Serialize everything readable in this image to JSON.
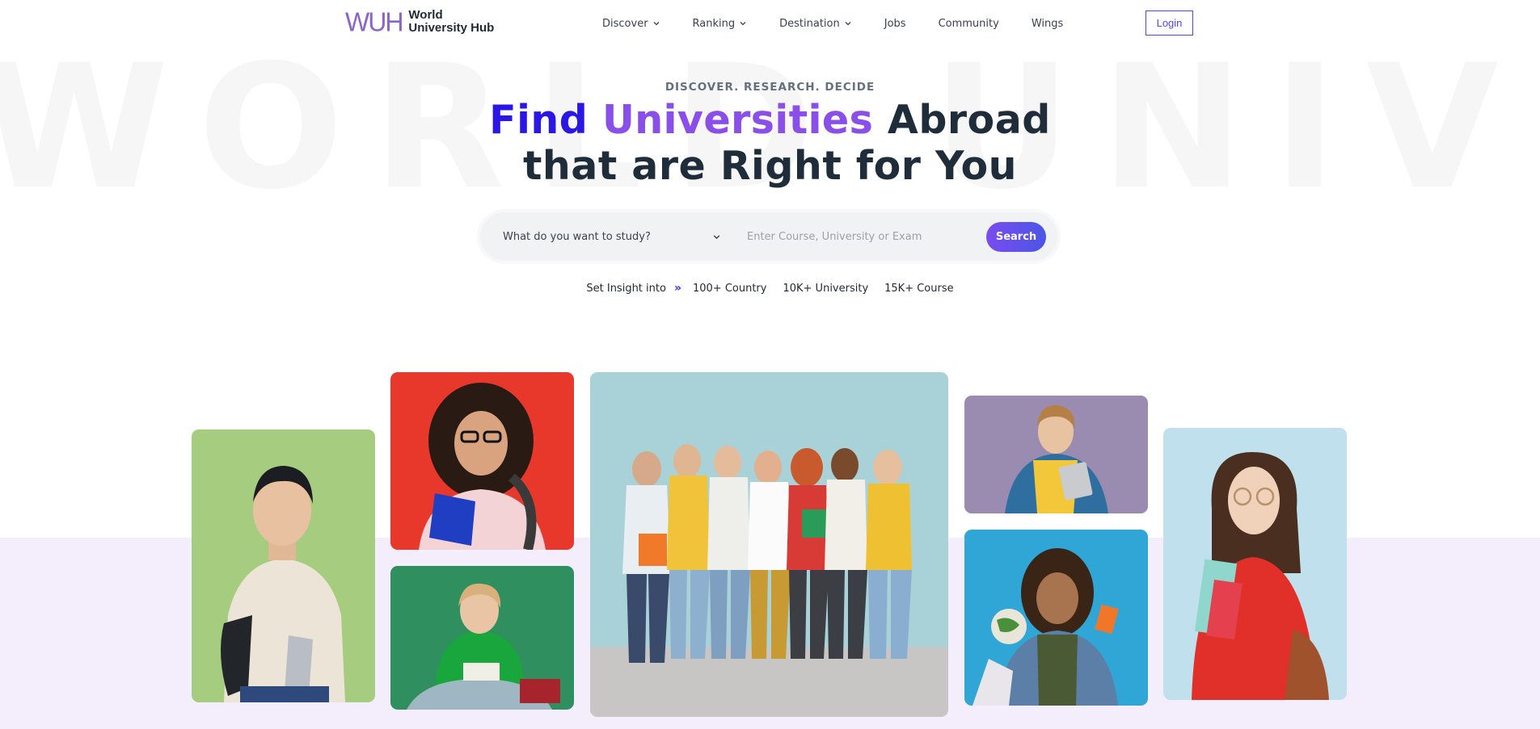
{
  "brand": {
    "mark": "WUH",
    "name_line1": "World",
    "name_line2": "University Hub",
    "mark_color": "#8b63c9"
  },
  "watermark": "WORLD UNIVERSITY",
  "nav": {
    "items": [
      {
        "label": "Discover",
        "has_dropdown": true
      },
      {
        "label": "Ranking",
        "has_dropdown": true
      },
      {
        "label": "Destination",
        "has_dropdown": true
      },
      {
        "label": "Jobs",
        "has_dropdown": false
      },
      {
        "label": "Community",
        "has_dropdown": false
      },
      {
        "label": "Wings",
        "has_dropdown": false
      }
    ],
    "login_label": "Login"
  },
  "hero": {
    "tagline": "DISCOVER. RESEARCH. DECIDE",
    "headline_find": "Find",
    "headline_universities": "Universities",
    "headline_abroad": "Abroad",
    "headline_line2": "that are Right for You"
  },
  "search": {
    "study_select_label": "What do you want to study?",
    "query_placeholder": "Enter Course, University or Exam",
    "button_label": "Search"
  },
  "insight": {
    "label": "Set Insight into",
    "arrows": "»",
    "stats": [
      "100+ Country",
      "10K+ University",
      "15K+ Course"
    ]
  },
  "colors": {
    "accent": "#4f46e5",
    "headline_blue": "#2a17e6",
    "headline_purple": "#8a4fe9",
    "lavender_band": "#f4eefc"
  },
  "photos": [
    {
      "name": "student-green-background",
      "bg": "#a6cd7f"
    },
    {
      "name": "student-red-background",
      "bg": "#e8382c"
    },
    {
      "name": "student-dark-green-background",
      "bg": "#2f8f5f"
    },
    {
      "name": "group-of-students",
      "bg": "#a9d2d8"
    },
    {
      "name": "student-purple-background",
      "bg": "#9a8bb0"
    },
    {
      "name": "student-blue-background-globe",
      "bg": "#2fa6d6"
    },
    {
      "name": "student-light-blue-background",
      "bg": "#bfe0ec"
    }
  ]
}
